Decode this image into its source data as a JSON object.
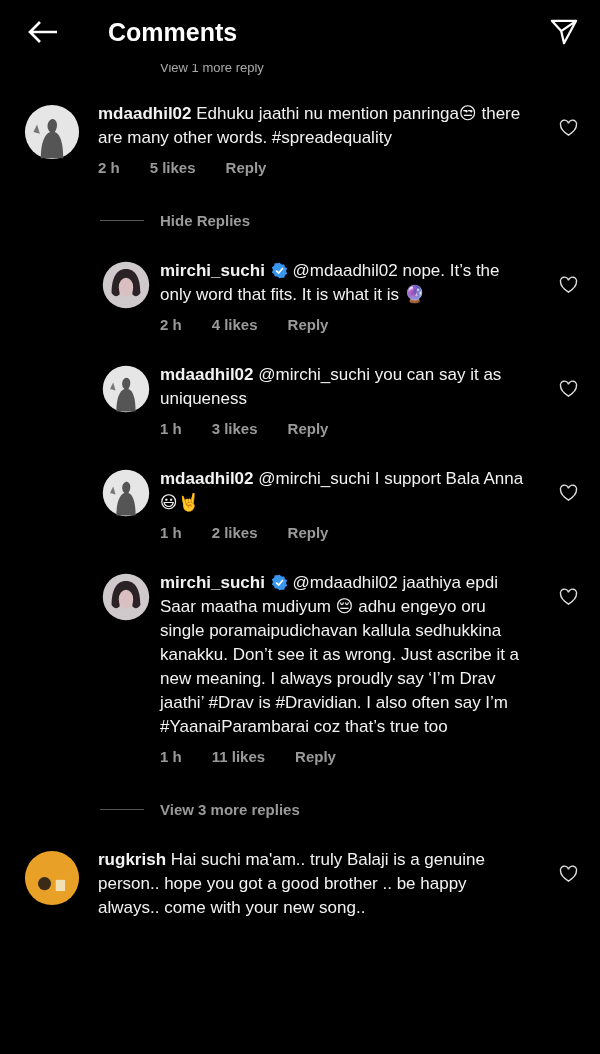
{
  "header": {
    "title": "Comments"
  },
  "partial_toggle": {
    "label": "View 1 more reply"
  },
  "comments": [
    {
      "kind": "silhouette",
      "user": "mdaadhil02",
      "verified": false,
      "text": "Edhuku jaathi nu mention panringa😒  there are many other words. #spreadequality",
      "time": "2 h",
      "likes": "5 likes",
      "reply": "Reply",
      "liked": false,
      "toggle": "Hide Replies",
      "children": [
        {
          "kind": "woman",
          "user": "mirchi_suchi",
          "verified": true,
          "text": "@mdaadhil02 nope. It’s the only word that fits. It is what it is 🔮",
          "time": "2 h",
          "likes": "4 likes",
          "reply": "Reply",
          "liked": false
        },
        {
          "kind": "silhouette",
          "user": "mdaadhil02",
          "verified": false,
          "text": "@mirchi_suchi  you can say it as uniqueness",
          "time": "1 h",
          "likes": "3 likes",
          "reply": "Reply",
          "liked": false
        },
        {
          "kind": "silhouette",
          "user": "mdaadhil02",
          "verified": false,
          "text": "@mirchi_suchi  I support Bala Anna 😃🤘",
          "time": "1 h",
          "likes": "2 likes",
          "reply": "Reply",
          "liked": false
        },
        {
          "kind": "woman",
          "user": "mirchi_suchi",
          "verified": true,
          "text": "@mdaadhil02 jaathiya epdi Saar maatha mudiyum 😔 adhu engeyo oru single poramaipudichavan kallula sedhukkina kanakku. Don’t see it as wrong. Just ascribe it a new meaning. I always proudly say ‘I’m Drav jaathi’ #Drav is #Dravidian. I also often say I’m #YaanaiParambarai coz that’s true too",
          "time": "1 h",
          "likes": "11 likes",
          "reply": "Reply",
          "liked": false
        }
      ],
      "more": "View 3 more replies"
    },
    {
      "kind": "orange",
      "user": "rugkrish",
      "verified": false,
      "text": "Hai suchi ma'am.. truly Balaji is a genuine person.. hope you got a good brother .. be happy always.. come with your new song..",
      "liked": false
    }
  ]
}
